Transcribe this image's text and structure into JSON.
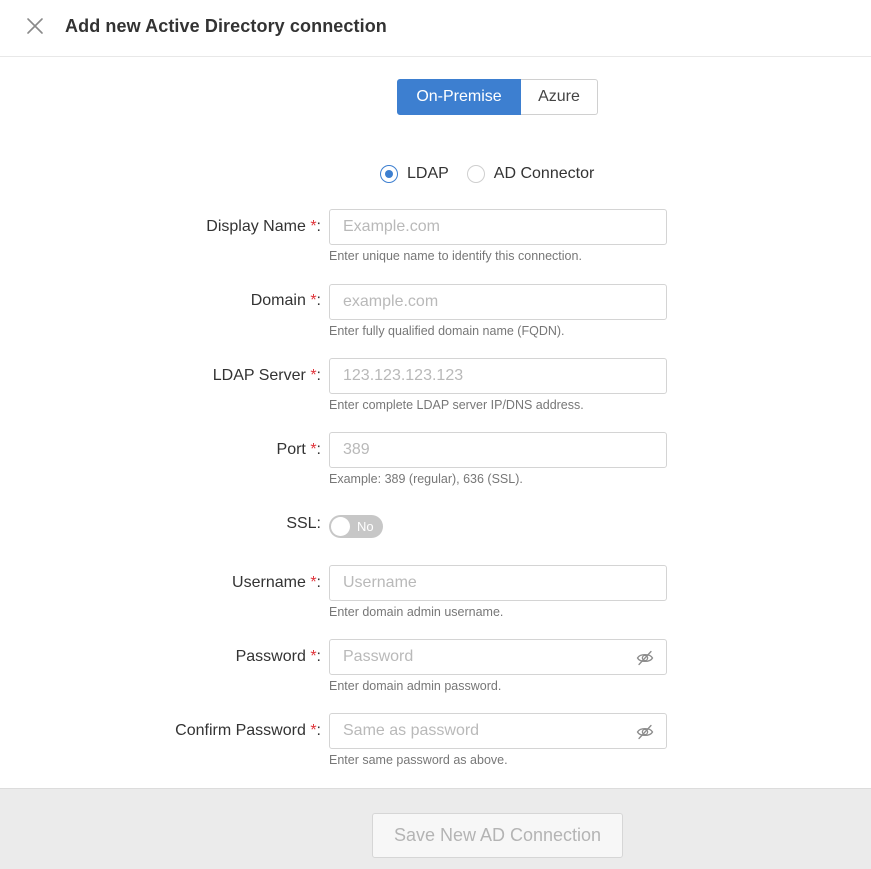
{
  "header": {
    "title": "Add new Active Directory connection",
    "close_icon": "close-icon"
  },
  "segmented": {
    "options": [
      "On-Premise",
      "Azure"
    ],
    "selected": "On-Premise"
  },
  "connection_type": {
    "options": [
      "LDAP",
      "AD Connector"
    ],
    "selected": "LDAP"
  },
  "colors": {
    "accent": "#3d7fd0",
    "required": "#e0343b",
    "toggle_off": "#c7c7c7",
    "footer_bg": "#ebebeb"
  },
  "form": {
    "required_mark": "*",
    "fields": [
      {
        "label": "Display Name",
        "placeholder": "Example.com",
        "value": "",
        "help": "Enter unique name to identify this connection."
      },
      {
        "label": "Domain",
        "placeholder": "example.com",
        "value": "",
        "help": "Enter fully qualified domain name (FQDN)."
      },
      {
        "label": "LDAP Server",
        "placeholder": "123.123.123.123",
        "value": "",
        "help": "Enter complete LDAP server IP/DNS address."
      },
      {
        "label": "Port",
        "placeholder": "389",
        "value": "",
        "help": "Example: 389 (regular), 636 (SSL)."
      },
      {
        "label": "Username",
        "placeholder": "Username",
        "value": "",
        "help": "Enter domain admin username."
      },
      {
        "label": "Password",
        "placeholder": "Password",
        "value": "",
        "help": "Enter domain admin password.",
        "icon": "eye-slash-icon"
      },
      {
        "label": "Confirm Password",
        "placeholder": "Same as password",
        "value": "",
        "help": "Enter same password as above.",
        "icon": "eye-slash-icon"
      }
    ],
    "ssl": {
      "label": "SSL:",
      "state": "No"
    }
  },
  "footer": {
    "save_label": "Save New AD Connection",
    "save_enabled": false
  }
}
